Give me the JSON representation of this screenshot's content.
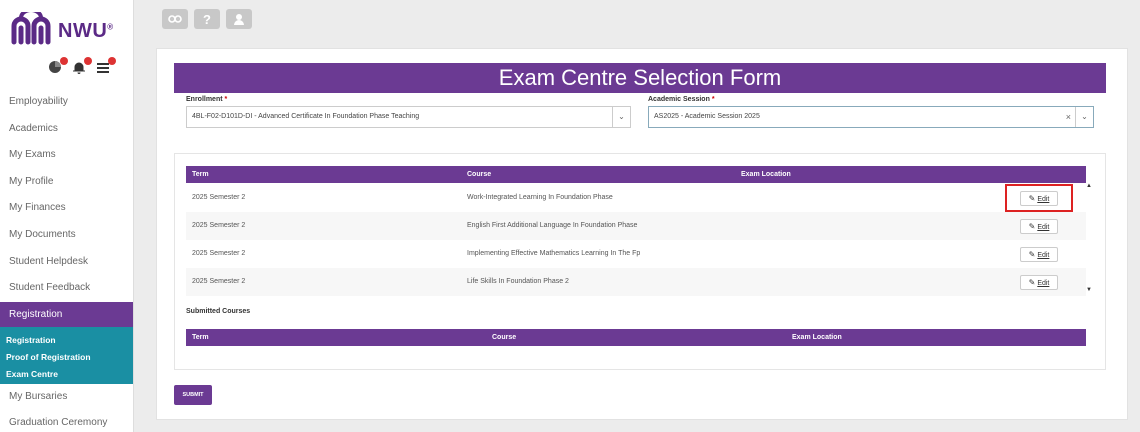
{
  "brand": {
    "name": "NWU",
    "mark": "®"
  },
  "notifications": [
    {
      "icon": "pie-chart-icon"
    },
    {
      "icon": "bell-icon"
    },
    {
      "icon": "list-icon"
    }
  ],
  "top_icons": [
    {
      "icon": "link-icon"
    },
    {
      "icon": "help-icon",
      "glyph": "?"
    },
    {
      "icon": "user-icon"
    }
  ],
  "sidebar": {
    "items_before": [
      "Employability",
      "Academics",
      "My Exams",
      "My Profile",
      "My Finances",
      "My Documents",
      "Student Helpdesk",
      "Student Feedback"
    ],
    "active": "Registration",
    "sub_items": [
      "Registration",
      "Proof of Registration",
      "Exam Centre"
    ],
    "items_after": [
      "My Bursaries",
      "Graduation Ceremony"
    ]
  },
  "form": {
    "title": "Exam Centre Selection Form",
    "enrollment_label": "Enrollment",
    "enrollment_value": "4BL-F02-D101D-DI - Advanced Certificate In Foundation Phase Teaching",
    "session_label": "Academic Session",
    "session_value": "AS2025 - Academic Session 2025",
    "required_mark": "*"
  },
  "courses_table": {
    "headers": {
      "term": "Term",
      "course": "Course",
      "location": "Exam Location"
    },
    "rows": [
      {
        "term": "2025 Semester 2",
        "course": "Work-Integrated Learning In Foundation Phase",
        "action": "Edit"
      },
      {
        "term": "2025 Semester 2",
        "course": "English First Additional Language In Foundation Phase",
        "action": "Edit"
      },
      {
        "term": "2025 Semester 2",
        "course": "Implementing Effective Mathematics Learning In The Fp",
        "action": "Edit"
      },
      {
        "term": "2025 Semester 2",
        "course": "Life Skills In Foundation Phase 2",
        "action": "Edit"
      }
    ]
  },
  "submitted": {
    "label": "Submitted Courses",
    "headers": {
      "term": "Term",
      "course": "Course",
      "location": "Exam Location"
    }
  },
  "submit_label": "SUBMIT",
  "colors": {
    "brand_purple": "#6b3a93",
    "sub_nav_teal": "#1a8fa3",
    "highlight_red": "#d22222"
  }
}
